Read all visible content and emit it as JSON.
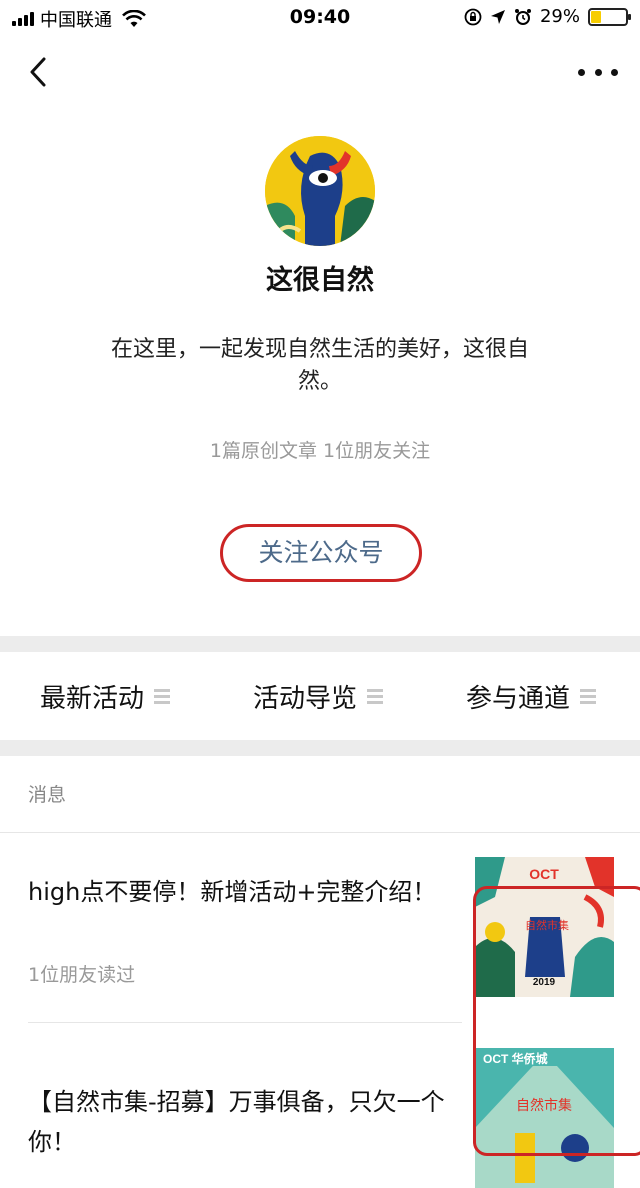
{
  "status_bar": {
    "carrier": "中国联通",
    "time": "09:40",
    "battery_percent": "29%",
    "battery_level": 0.29
  },
  "nav": {
    "back_icon": "chevron-left-icon",
    "more_icon": "more-dots-icon"
  },
  "profile": {
    "name": "这很自然",
    "description": "在这里，一起发现自然生活的美好，这很自然。",
    "stats": "1篇原创文章  1位朋友关注",
    "follow_label": "关注公众号"
  },
  "menu": {
    "items": [
      {
        "label": "最新活动"
      },
      {
        "label": "活动导览"
      },
      {
        "label": "参与通道"
      }
    ]
  },
  "messages": {
    "section_label": "消息",
    "items": [
      {
        "title": "high点不要停！新增活动+完整介绍！",
        "meta": "1位朋友读过",
        "thumbnail_text": [
          "OCT",
          "2019",
          "自然市集"
        ]
      },
      {
        "title": "【自然市集-招募】万事俱备，只欠一个你！",
        "meta": "",
        "thumbnail_text": [
          "OCT 华侨城",
          "自然市集"
        ]
      }
    ]
  },
  "colors": {
    "follow_text": "#4d6a8a",
    "highlight": "#cc2525",
    "battery": "#f7cd00"
  }
}
